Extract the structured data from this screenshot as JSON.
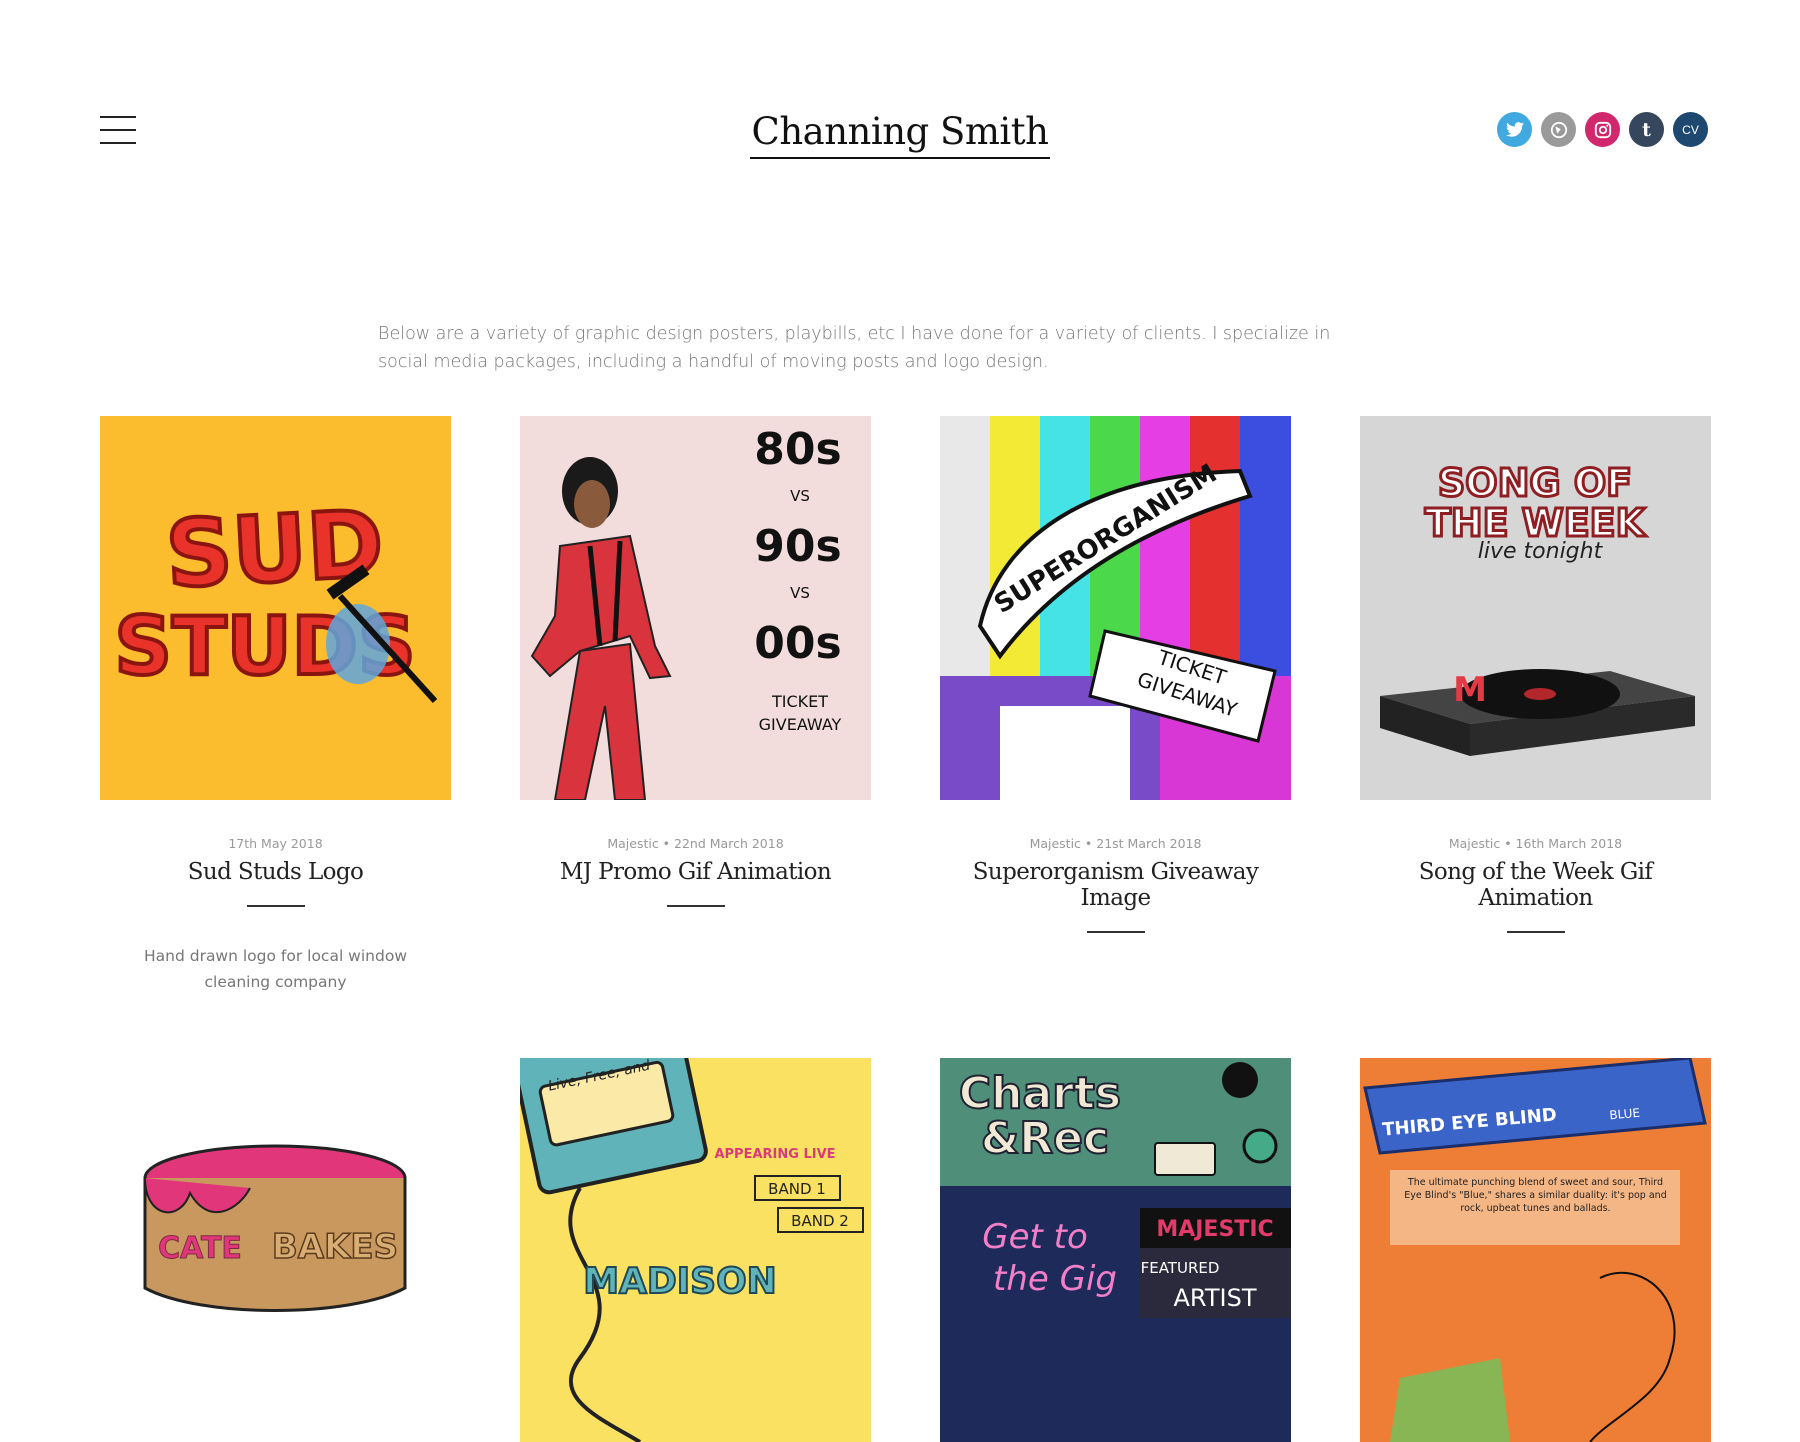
{
  "site": {
    "title": "Channing Smith"
  },
  "social": [
    {
      "name": "twitter",
      "glyph": "🐦",
      "color": "#3fa9e0"
    },
    {
      "name": "behance",
      "glyph": "◀",
      "color": "#9a9a9a"
    },
    {
      "name": "instagram",
      "glyph": "◎",
      "color": "#d1286d"
    },
    {
      "name": "tumblr",
      "glyph": "t",
      "color": "#36465d"
    },
    {
      "name": "cv",
      "glyph": "CV",
      "color": "#1f4870"
    }
  ],
  "intro": "Below are a variety of graphic design posters, playbills, etc I have done for a variety of clients. I specialize in social media packages, including a handful of moving posts and logo design.",
  "projects": [
    {
      "meta": "17th May 2018",
      "title": "Sud Studs Logo",
      "desc": "Hand drawn logo for local window cleaning company",
      "art": {
        "line1": "SUD",
        "line2": "STUDS"
      }
    },
    {
      "meta": "Majestic • 22nd March 2018",
      "title": "MJ Promo Gif Animation",
      "art": {
        "a": "80s",
        "vs1": "VS",
        "b": "90s",
        "vs2": "VS",
        "c": "00s",
        "t1": "TICKET",
        "t2": "GIVEAWAY"
      }
    },
    {
      "meta": "Majestic • 21st March 2018",
      "title": "Superorganism Giveaway Image",
      "art": {
        "band": "SUPERORGANISM",
        "t1": "TICKET",
        "t2": "GIVEAWAY"
      }
    },
    {
      "meta": "Majestic • 16th March 2018",
      "title": "Song of the Week Gif Animation",
      "art": {
        "l1": "SONG OF",
        "l2": "THE WEEK",
        "l3": "live tonight",
        "logo": "M"
      }
    },
    {
      "art": {
        "l1": "CATE",
        "l2": "BAKES"
      }
    },
    {
      "art": {
        "top": "Live, Free, and",
        "appear": "APPEARING LIVE",
        "b1": "BAND 1",
        "b2": "BAND 2",
        "venue": "MADISON"
      }
    },
    {
      "art": {
        "l1": "Charts",
        "l2": "&Rec",
        "gig1": "Get to",
        "gig2": "the Gig",
        "maj": "MAJESTIC",
        "feat": "FEATURED",
        "artist": "ARTIST"
      }
    },
    {
      "art": {
        "name": "THIRD EYE BLIND",
        "blue": "BLUE",
        "blurb": "The ultimate punching blend of sweet and sour, Third Eye Blind's \"Blue,\" shares a similar duality: it's pop and rock, upbeat tunes and ballads."
      }
    }
  ]
}
